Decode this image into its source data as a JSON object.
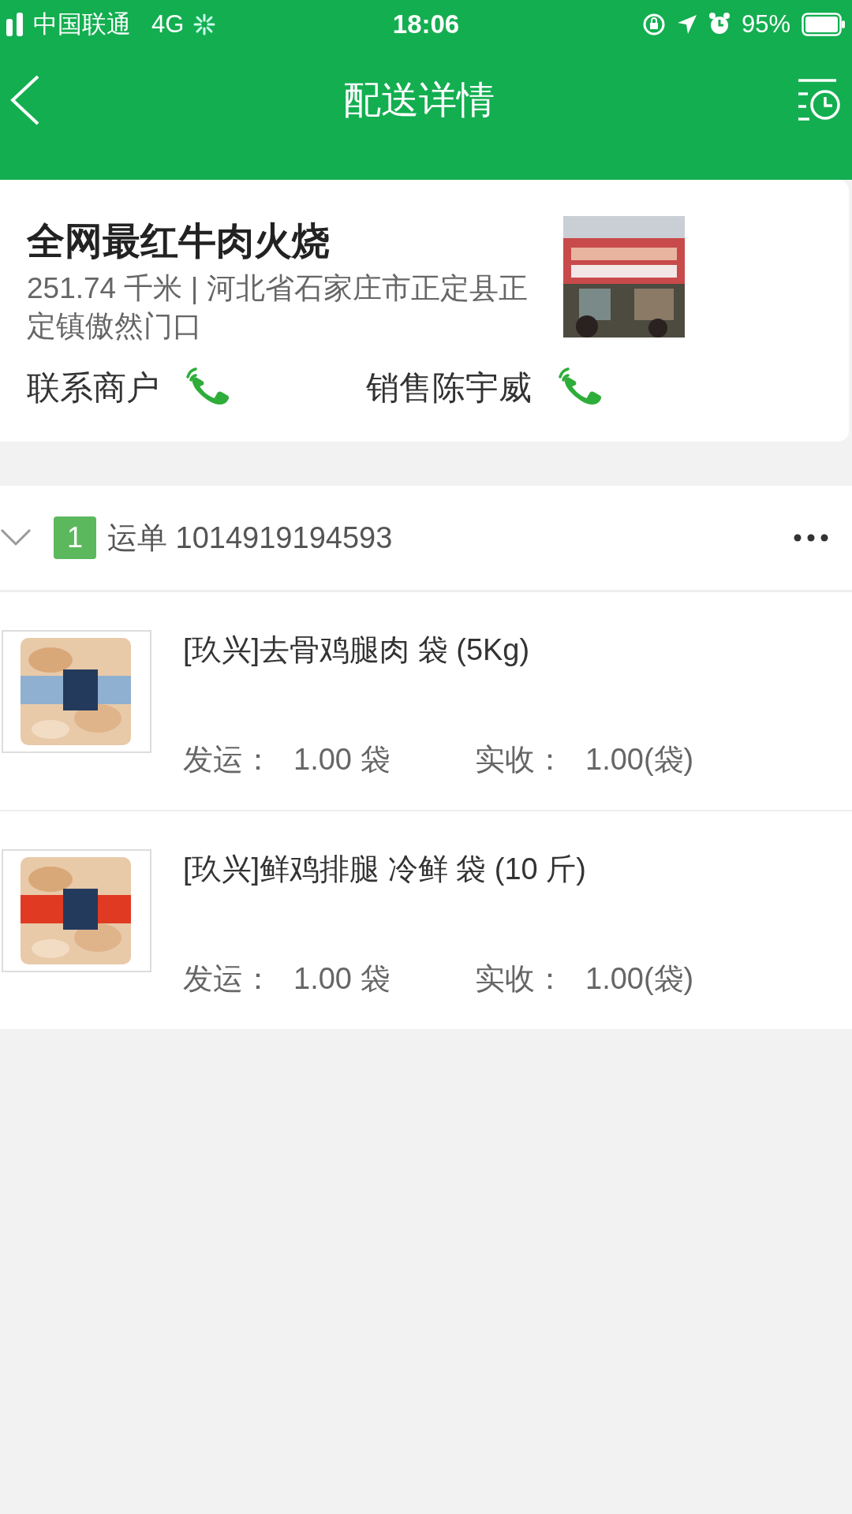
{
  "status_bar": {
    "carrier": "中国联通",
    "network": "4G",
    "time": "18:06",
    "battery": "95%"
  },
  "nav": {
    "title": "配送详情"
  },
  "store": {
    "name": "全网最红牛肉火烧",
    "address": "251.74 千米 | 河北省石家庄市正定县正定镇傲然门口",
    "contacts": [
      {
        "label": "联系商户"
      },
      {
        "label": "销售陈宇威"
      }
    ]
  },
  "waybill": {
    "expanded": true,
    "index": "1",
    "label": "运单",
    "number": "1014919194593",
    "items": [
      {
        "name": "[玖兴]去骨鸡腿肉 袋 (5Kg)",
        "shipped_label": "发运：",
        "shipped": "1.00 袋",
        "received_label": "实收：",
        "received": "1.00(袋)"
      },
      {
        "name": "[玖兴]鲜鸡排腿 冷鲜 袋 (10 斤)",
        "shipped_label": "发运：",
        "shipped": "1.00 袋",
        "received_label": "实收：",
        "received": "1.00(袋)"
      }
    ]
  }
}
